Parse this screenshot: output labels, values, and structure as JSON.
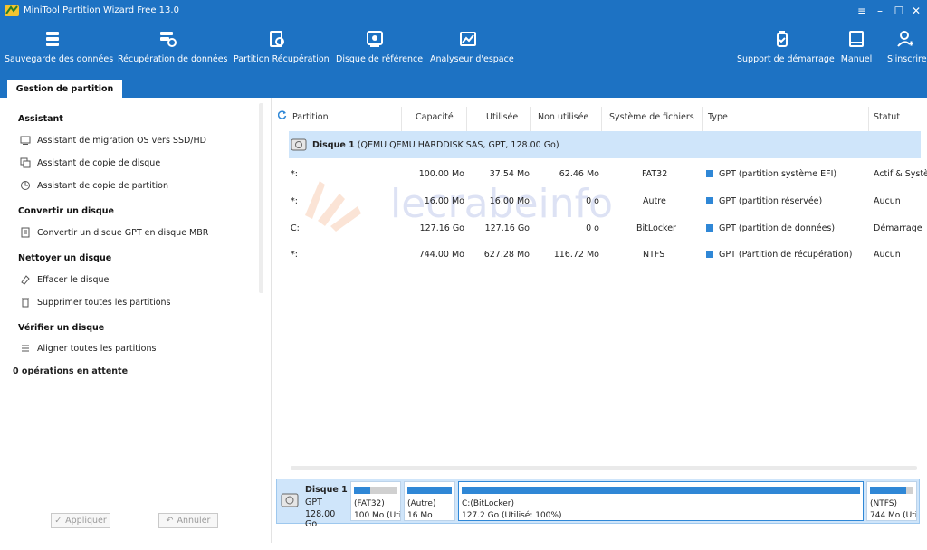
{
  "app": {
    "title": "MiniTool Partition Wizard Free 13.0"
  },
  "toolbar": {
    "left": [
      {
        "label": "Sauvegarde des données",
        "icon": "backup-icon"
      },
      {
        "label": "Récupération de données",
        "icon": "data-recovery-icon"
      },
      {
        "label": "Partition Récupération",
        "icon": "partition-recovery-icon"
      },
      {
        "label": "Disque de référence",
        "icon": "disk-benchmark-icon"
      },
      {
        "label": "Analyseur d'espace",
        "icon": "space-analyzer-icon"
      }
    ],
    "right": [
      {
        "label": "Support de démarrage",
        "icon": "bootable-media-icon"
      },
      {
        "label": "Manuel",
        "icon": "manual-icon"
      },
      {
        "label": "S'inscrire",
        "icon": "register-icon"
      }
    ]
  },
  "tab": {
    "label": "Gestion de partition"
  },
  "sidebar": {
    "sections": [
      {
        "title": "Assistant",
        "items": [
          "Assistant de migration OS vers SSD/HD",
          "Assistant de copie de disque",
          "Assistant de copie de partition"
        ]
      },
      {
        "title": "Convertir un disque",
        "items": [
          "Convertir un disque GPT en disque MBR"
        ]
      },
      {
        "title": "Nettoyer un disque",
        "items": [
          "Effacer le disque",
          "Supprimer toutes les partitions"
        ]
      },
      {
        "title": "Vérifier un disque",
        "items": [
          "Aligner toutes les partitions"
        ]
      }
    ],
    "pending": "0 opérations en attente",
    "apply_label": "Appliquer",
    "undo_label": "Annuler"
  },
  "table": {
    "columns": [
      "Partition",
      "Capacité",
      "Utilisée",
      "Non utilisée",
      "Système de fichiers",
      "Type",
      "Statut"
    ],
    "disk_label": "Disque 1",
    "disk_info": "(QEMU QEMU HARDDISK SAS, GPT, 128.00 Go)",
    "rows": [
      {
        "partition": "*:",
        "capacity": "100.00 Mo",
        "used": "37.54 Mo",
        "unused": "62.46 Mo",
        "fs": "FAT32",
        "type": "GPT (partition système EFI)",
        "status": "Actif & Systè"
      },
      {
        "partition": "*:",
        "capacity": "16.00 Mo",
        "used": "16.00 Mo",
        "unused": "0 o",
        "fs": "Autre",
        "type": "GPT (partition réservée)",
        "status": "Aucun"
      },
      {
        "partition": "C:",
        "capacity": "127.16 Go",
        "used": "127.16 Go",
        "unused": "0 o",
        "fs": "BitLocker",
        "type": "GPT (partition de données)",
        "status": "Démarrage"
      },
      {
        "partition": "*:",
        "capacity": "744.00 Mo",
        "used": "627.28 Mo",
        "unused": "116.72 Mo",
        "fs": "NTFS",
        "type": "GPT (Partition de récupération)",
        "status": "Aucun"
      }
    ],
    "watermark": "lecrabeinfo"
  },
  "diskmap": {
    "disk_name": "Disque 1",
    "disk_type": "GPT",
    "disk_size": "128.00 Go",
    "partitions": [
      {
        "line1": "(FAT32)",
        "line2": "100 Mo (Utili",
        "used_fraction": 0.38
      },
      {
        "line1": "(Autre)",
        "line2": "16 Mo",
        "used_fraction": 1.0
      },
      {
        "line1": "C:(BitLocker)",
        "line2": "127.2 Go (Utilisé: 100%)",
        "used_fraction": 1.0
      },
      {
        "line1": "(NTFS)",
        "line2": "744 Mo (Uti",
        "used_fraction": 0.84
      }
    ]
  },
  "colors": {
    "accent": "#1d72c3",
    "selected_row": "#cfe5fa",
    "partition_bar": "#2f87d6"
  }
}
